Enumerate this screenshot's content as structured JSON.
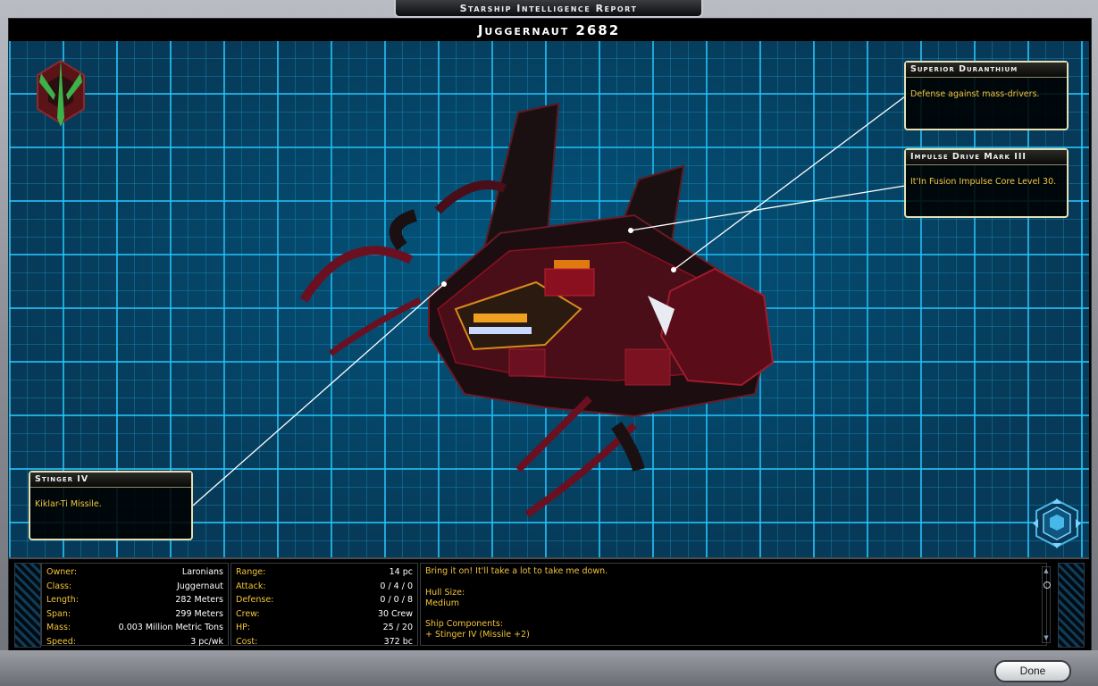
{
  "window": {
    "report_title": "Starship Intelligence Report",
    "ship_name": "Juggernaut 2682"
  },
  "callouts": [
    {
      "title": "Superior Duranthium",
      "description": "Defense against mass-drivers."
    },
    {
      "title": "Impulse Drive Mark III",
      "description": "It'In Fusion Impulse Core Level 30."
    },
    {
      "title": "Stinger IV",
      "description": "Kiklar-Ti Missile."
    }
  ],
  "stats_left": [
    {
      "label": "Owner:",
      "value": "Laronians"
    },
    {
      "label": "Class:",
      "value": "Juggernaut"
    },
    {
      "label": "Length:",
      "value": "282 Meters"
    },
    {
      "label": "Span:",
      "value": "299 Meters"
    },
    {
      "label": "Mass:",
      "value": "0.003 Million Metric Tons"
    },
    {
      "label": "Speed:",
      "value": "3 pc/wk"
    }
  ],
  "stats_right": [
    {
      "label": "Range:",
      "value": "14 pc"
    },
    {
      "label": "Attack:",
      "value": "0 / 4 / 0"
    },
    {
      "label": "Defense:",
      "value": "0 / 0 / 8"
    },
    {
      "label": "Crew:",
      "value": "30 Crew"
    },
    {
      "label": "HP:",
      "value": "25 / 20"
    },
    {
      "label": "Cost:",
      "value": "372 bc"
    }
  ],
  "description": {
    "quote": "Bring it on! It'll take a lot to take me down.",
    "hull_label": "Hull Size:",
    "hull_value": "Medium",
    "components_label": "Ship Components:",
    "component_1": "+ Stinger IV (Missile +2)"
  },
  "buttons": {
    "done": "Done"
  },
  "colors": {
    "grid": "#28c8ff",
    "accent_text": "#f2c43a",
    "callout_border": "#e6e0b4",
    "ship_red": "#8a1020"
  },
  "icons": {
    "emblem": "race-emblem-icon",
    "rotate": "rotate-view-icon"
  }
}
